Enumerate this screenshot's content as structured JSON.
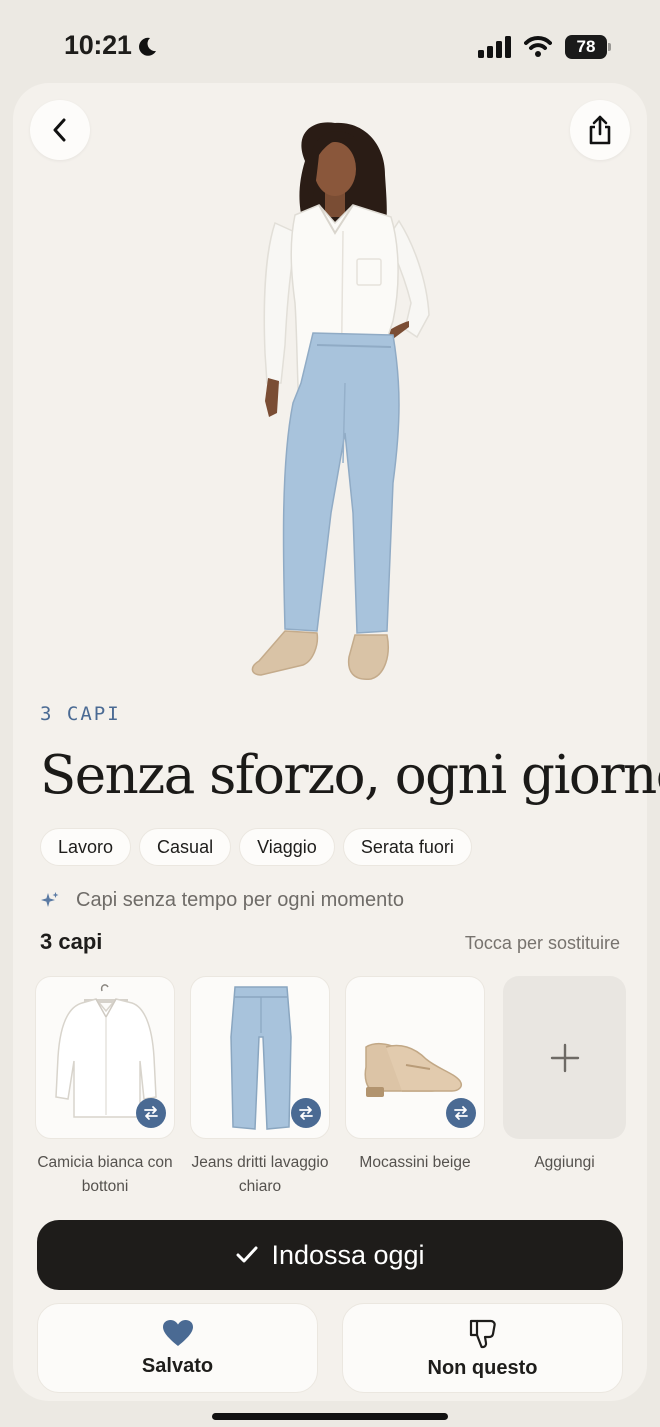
{
  "status_bar": {
    "time": "10:21",
    "battery": "78"
  },
  "hero": {
    "image_alt": "Woman in white shirt, light blue straight jeans and beige loafers"
  },
  "outfit": {
    "eyebrow": "3 CAPI",
    "title": "Senza sforzo, ogni giorno",
    "tags": [
      "Lavoro",
      "Casual",
      "Viaggio",
      "Serata fuori"
    ],
    "tagline": "Capi senza tempo per ogni momento"
  },
  "items_section": {
    "count_label": "3 capi",
    "hint": "Tocca per sostituire",
    "items": [
      {
        "label": "Camicia bianca con bottoni",
        "icon": "shirt-icon"
      },
      {
        "label": "Jeans dritti lavaggio chiaro",
        "icon": "jeans-icon"
      },
      {
        "label": "Mocassini beige",
        "icon": "loafers-icon"
      }
    ],
    "add_label": "Aggiungi"
  },
  "actions": {
    "primary_label": "Indossa oggi",
    "save_label": "Salvato",
    "dislike_label": "Non questo"
  },
  "colors": {
    "accent": "#4a6a93",
    "primary_button": "#1e1c1a",
    "card_bg": "#f4f1ec",
    "page_bg": "#ece9e3"
  }
}
